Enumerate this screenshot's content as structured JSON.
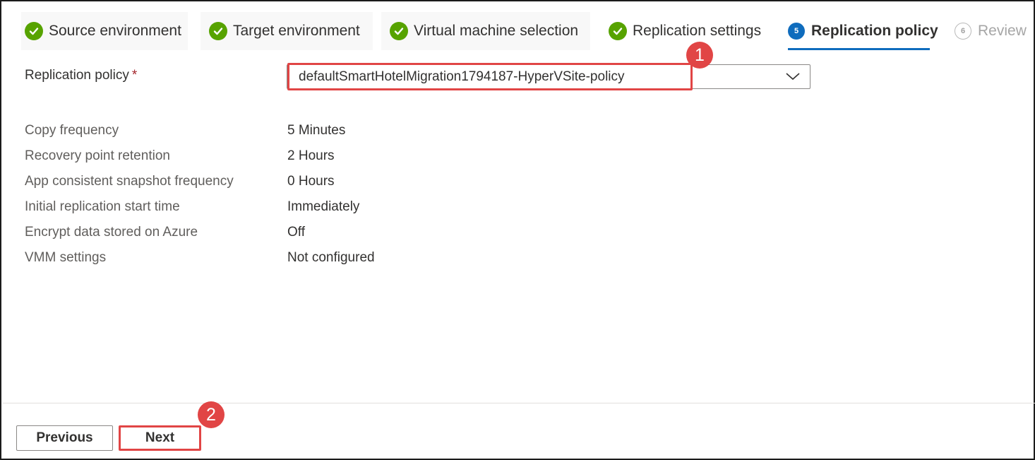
{
  "wizard": {
    "tabs": [
      {
        "label": "Source environment",
        "state": "done"
      },
      {
        "label": "Target environment",
        "state": "done"
      },
      {
        "label": "Virtual machine selection",
        "state": "done"
      },
      {
        "label": "Replication settings",
        "state": "done"
      },
      {
        "label": "Replication policy",
        "state": "active",
        "number": "5"
      },
      {
        "label": "Review",
        "state": "pending",
        "number": "6"
      }
    ]
  },
  "form": {
    "policy_label": "Replication policy",
    "required_marker": "*",
    "policy_value": "defaultSmartHotelMigration1794187-HyperVSite-policy",
    "details": [
      {
        "key": "Copy frequency",
        "value": "5 Minutes"
      },
      {
        "key": "Recovery point retention",
        "value": "2 Hours"
      },
      {
        "key": "App consistent snapshot frequency",
        "value": "0 Hours"
      },
      {
        "key": "Initial replication start time",
        "value": "Immediately"
      },
      {
        "key": "Encrypt data stored on Azure",
        "value": "Off"
      },
      {
        "key": "VMM settings",
        "value": "Not configured"
      }
    ]
  },
  "footer": {
    "previous_label": "Previous",
    "next_label": "Next"
  },
  "callouts": {
    "one": "1",
    "two": "2"
  },
  "colors": {
    "accent": "#0f6cbd",
    "success": "#57a300",
    "highlight": "#e14545",
    "required": "#a4262c"
  },
  "icons": {
    "done": "checkmark-circle-icon",
    "dropdown": "chevron-down-icon"
  }
}
